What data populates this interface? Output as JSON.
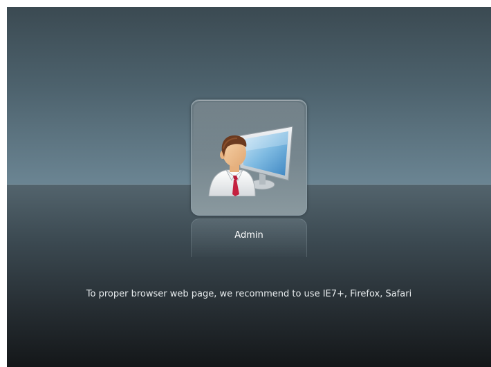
{
  "login": {
    "account_label": "Admin",
    "icon": "admin-user-computer-icon"
  },
  "footer": {
    "recommendation": "To proper browser web page, we recommend to use IE7+, Firefox, Safari"
  },
  "colors": {
    "backdrop_top": "#4d626d",
    "backdrop_horizon": "#6b8593",
    "backdrop_bottom": "#141719",
    "tile": "#76868e",
    "tie": "#c4203f"
  }
}
